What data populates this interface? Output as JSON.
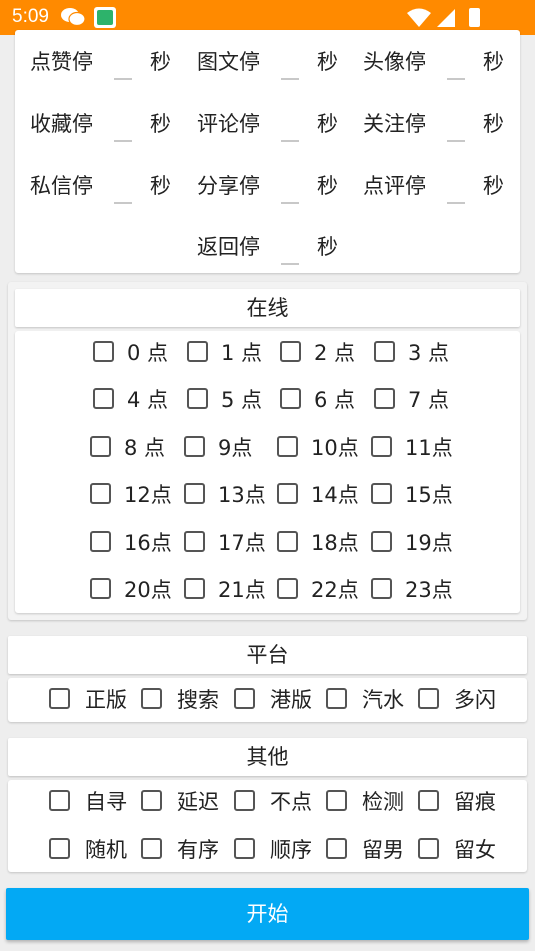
{
  "status_bar": {
    "time": "5:09"
  },
  "pause_settings": {
    "unit": "秒",
    "rows": [
      [
        "点赞停",
        "图文停",
        "头像停"
      ],
      [
        "收藏停",
        "评论停",
        "关注停"
      ],
      [
        "私信停",
        "分享停",
        "点评停"
      ],
      [
        "",
        "返回停",
        ""
      ]
    ]
  },
  "online": {
    "title": "在线",
    "hours": [
      "0 点",
      "1 点",
      "2 点",
      "3 点",
      "4 点",
      "5 点",
      "6 点",
      "7 点",
      "8 点",
      "9点",
      "10点",
      "11点",
      "12点",
      "13点",
      "14点",
      "15点",
      "16点",
      "17点",
      "18点",
      "19点",
      "20点",
      "21点",
      "22点",
      "23点"
    ]
  },
  "platform": {
    "title": "平台",
    "options": [
      "正版",
      "搜索",
      "港版",
      "汽水",
      "多闪"
    ]
  },
  "other": {
    "title": "其他",
    "options": [
      "自寻",
      "延迟",
      "不点",
      "检测",
      "留痕",
      "随机",
      "有序",
      "顺序",
      "留男",
      "留女"
    ]
  },
  "start_button": {
    "label": "开始"
  },
  "colors": {
    "status_bar": "#ff8a00",
    "start_button": "#03a9f4"
  }
}
